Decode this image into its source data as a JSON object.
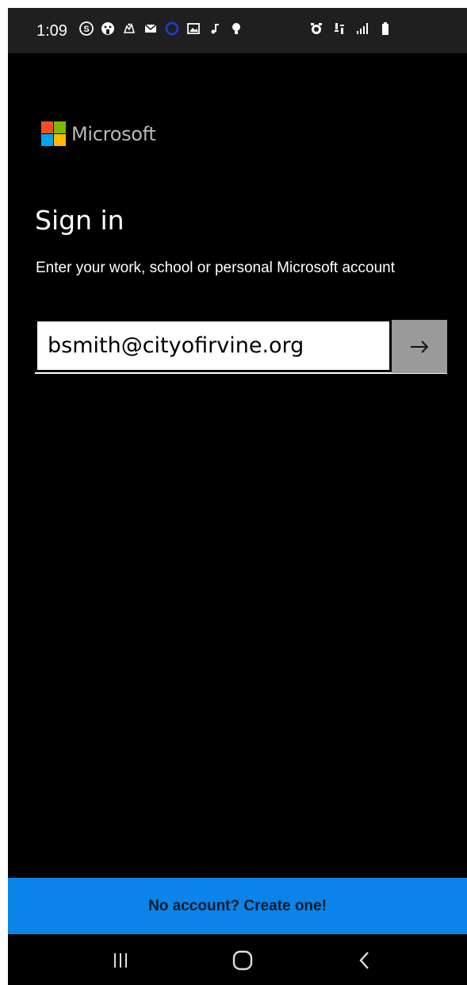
{
  "status_bar": {
    "time": "1:09",
    "left_icons": [
      "skype-icon",
      "face-icon",
      "animal-icon",
      "mail-icon",
      "circle-c-icon",
      "image-icon",
      "music-note-icon",
      "bulb-icon"
    ],
    "right_icons": [
      "alarm-icon",
      "data-icon",
      "signal-icon",
      "battery-icon"
    ]
  },
  "brand": {
    "name": "Microsoft",
    "logo_colors": [
      "#f25022",
      "#7fba00",
      "#00a4ef",
      "#ffb900"
    ]
  },
  "page": {
    "title": "Sign in",
    "description": "Enter your work, school or personal Microsoft account"
  },
  "email": {
    "value": "bsmith@cityofirvine.org"
  },
  "next_button": {
    "icon": "arrow-right-icon",
    "label": "→"
  },
  "banner": {
    "text": "No account? Create one!",
    "color": "#0a84e8"
  },
  "nav_bar": {
    "buttons": [
      "recent-apps-icon",
      "home-icon",
      "back-icon"
    ]
  }
}
